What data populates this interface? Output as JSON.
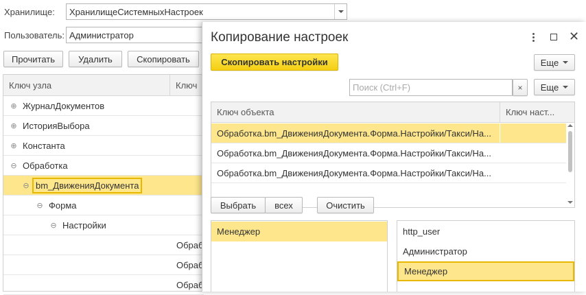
{
  "main": {
    "storage_label": "Хранилище:",
    "storage_value": "ХранилищеСистемныхНастроек",
    "user_label": "Пользователь:",
    "user_value": "Администратор",
    "buttons": {
      "read": "Прочитать",
      "delete": "Удалить",
      "copy": "Скопировать"
    },
    "tree": {
      "col_node_key": "Ключ узла",
      "col_key": "Ключ",
      "items": [
        {
          "label": "ЖурналДокументов",
          "expander": "⊕"
        },
        {
          "label": "ИсторияВыбора",
          "expander": "⊕"
        },
        {
          "label": "Константа",
          "expander": "⊕"
        },
        {
          "label": "Обработка",
          "expander": "⊖"
        },
        {
          "label": "bm_ДвиженияДокумента",
          "expander": "⊖"
        },
        {
          "label": "Форма",
          "expander": "⊖"
        },
        {
          "label": "Настройки",
          "expander": "⊖"
        }
      ],
      "key_cells": [
        "Обраб",
        "Обраб",
        "Обраб"
      ]
    }
  },
  "dialog": {
    "title": "Копирование настроек",
    "window_icons": [
      "more-icon",
      "maximize-icon",
      "close-icon"
    ],
    "copy_button": "Скопировать настройки",
    "more_button": "Еще",
    "search_placeholder": "Поиск (Ctrl+F)",
    "search_clear": "×",
    "table": {
      "col_object_key": "Ключ объекта",
      "col_settings_key": "Ключ наст...",
      "rows": [
        "Обработка.bm_ДвиженияДокумента.Форма.Настройки/Такси/На...",
        "Обработка.bm_ДвиженияДокумента.Форма.Настройки/Такси/На...",
        "Обработка.bm_ДвиженияДокумента.Форма.Настройки/Такси/На..."
      ]
    },
    "select_button": "Выбрать",
    "all_button": "всех",
    "clear_button": "Очистить",
    "selected_users": [
      "Менеджер"
    ],
    "all_users": [
      "http_user",
      "Администратор",
      "Менеджер"
    ]
  },
  "colors": {
    "accent_yellow": "#f5cf12",
    "selection": "#fde68c",
    "selection_border": "#e8b800"
  }
}
